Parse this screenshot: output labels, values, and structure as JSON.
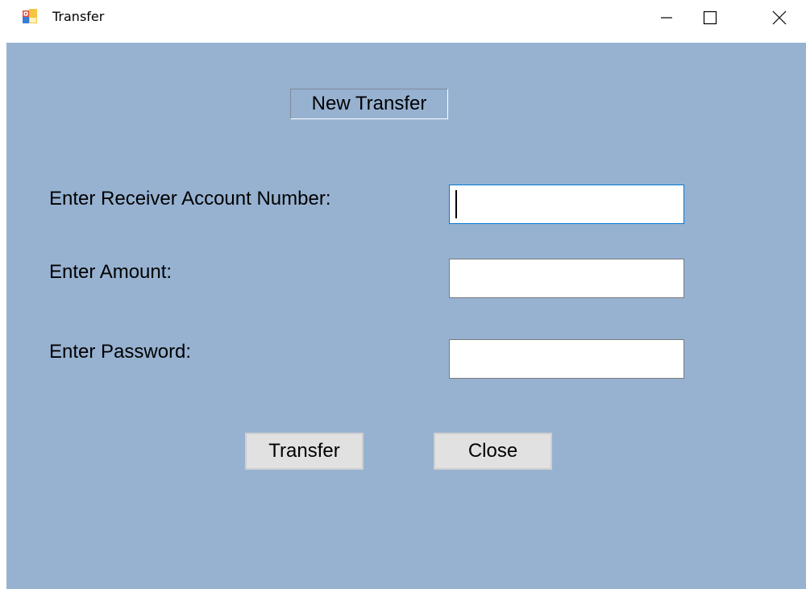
{
  "window": {
    "title": "Transfer",
    "icon": "winforms-app-icon",
    "controls": {
      "minimize": "minimize-icon",
      "maximize": "maximize-icon",
      "close": "close-icon"
    }
  },
  "form": {
    "heading": "New Transfer",
    "fields": [
      {
        "label": "Enter Receiver Account Number:",
        "value": "",
        "focused": true
      },
      {
        "label": "Enter Amount:",
        "value": ""
      },
      {
        "label": "Enter Password:",
        "value": ""
      }
    ],
    "buttons": {
      "transfer": "Transfer",
      "close": "Close"
    }
  },
  "colors": {
    "client_background": "#97b2d1",
    "focus_border": "#0078d7",
    "button_face": "#e1e1e1"
  }
}
